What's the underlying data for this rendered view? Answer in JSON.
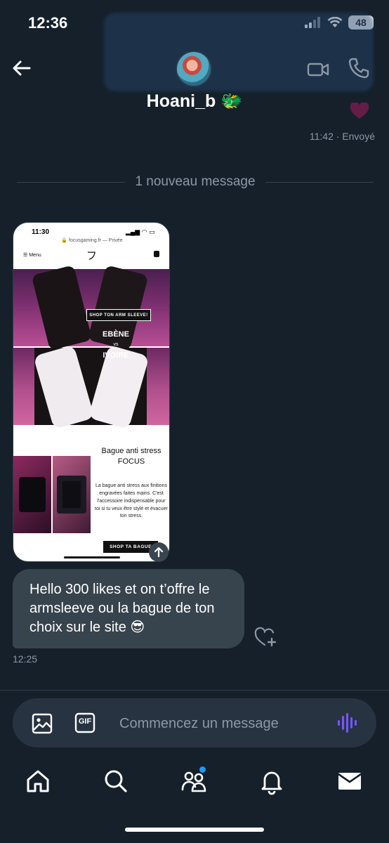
{
  "status_bar": {
    "time": "12:36",
    "battery": "48"
  },
  "header": {
    "contact_name": "Hoani_b 🐲",
    "icons": {
      "back": "arrow-left-icon",
      "video": "video-call-icon",
      "phone": "phone-icon"
    }
  },
  "messages": {
    "sent_meta": "11:42 · Envoyé",
    "new_divider": "1 nouveau message",
    "image": {
      "time": "11:30",
      "url": "🔒 focusgaming.fr — Privée",
      "menu": "☰ Menu",
      "logo": "フ",
      "shop_arm": "SHOP TON ARM SLEEVE!",
      "ebene": "EBÈNE",
      "vs": "vs",
      "ivoire": "IVOIRE",
      "bague_title": "Bague anti stress\nFOCUS",
      "bague_desc": "La bague anti stress aux finitions engravées faites mains. C'est l'accessoire indispensable pour toi si tu veux être stylé et évacuer ton stress.",
      "shop_bague": "SHOP TA BAGUE"
    },
    "received": {
      "text": "Hello 300 likes et on t’offre le armsleeve ou la bague de ton choix sur le site 😎",
      "time": "12:25"
    }
  },
  "composer": {
    "placeholder": "Commencez un message",
    "gif_label": "GIF"
  },
  "nav": {
    "items": [
      "home-icon",
      "search-icon",
      "communities-icon",
      "notifications-icon",
      "messages-icon"
    ]
  },
  "colors": {
    "background": "#15202b",
    "bubble": "#38444d",
    "accent": "#1d9bf0",
    "voice": "#7856ff"
  }
}
